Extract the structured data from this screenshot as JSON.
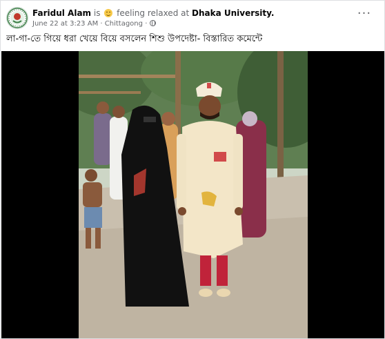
{
  "post": {
    "author": "Faridul Alam",
    "is_text": "is",
    "feeling_text": "feeling relaxed at",
    "feeling_icon": "relaxed-face-emoji",
    "place": "Dhaka University.",
    "date": "June 22 at 3:23 AM",
    "location": "Chittagong",
    "separator": "·",
    "privacy_icon": "globe-icon",
    "more_icon": "ellipsis-icon",
    "more_glyph": "···",
    "caption": "লা-গা-তে গিয়ে ধরা খেয়ে বিয়ে বসলেন শিশু উপদেষ্টা- বিস্তারিত কমেন্টে"
  },
  "colors": {
    "name_text": "#050505",
    "secondary_text": "#65676b",
    "media_background": "#000000"
  }
}
